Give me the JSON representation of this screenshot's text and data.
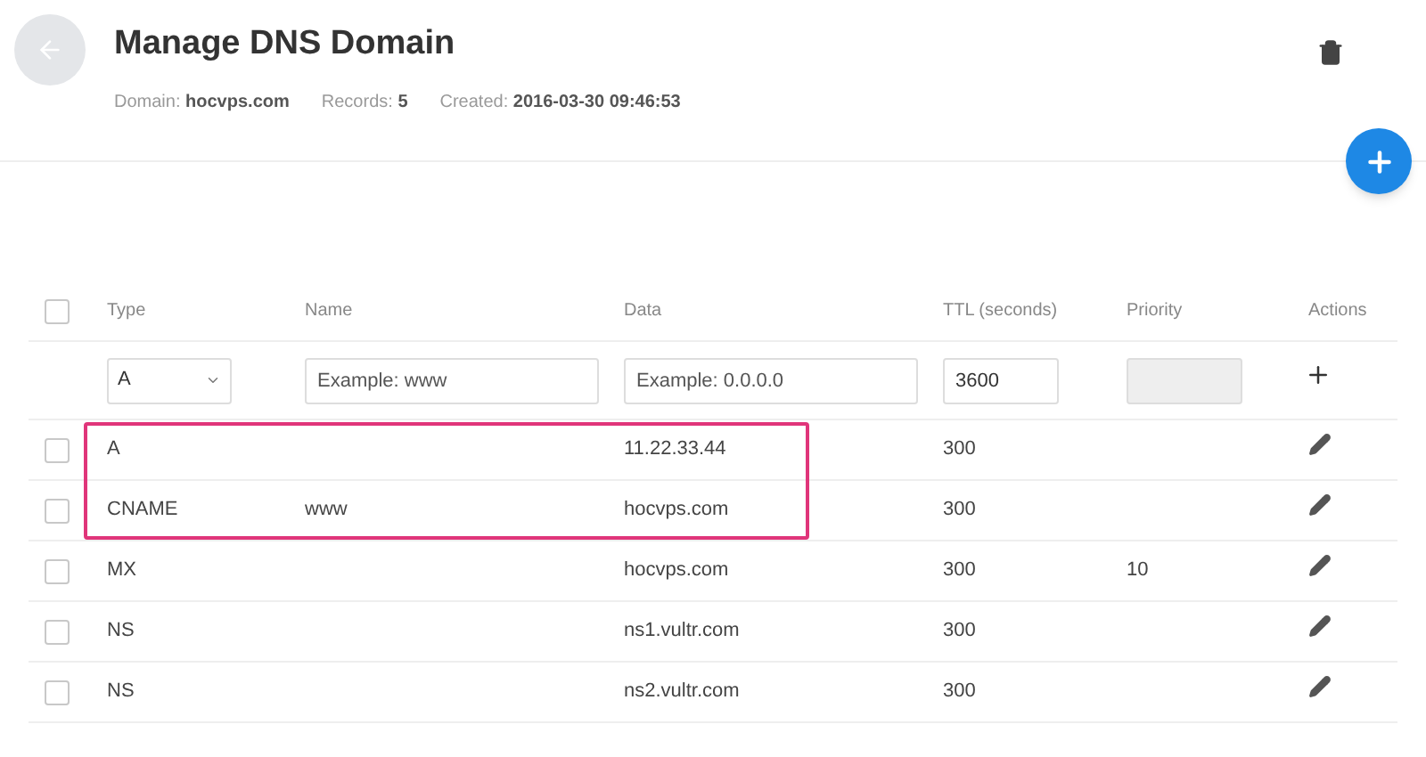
{
  "header": {
    "title": "Manage DNS Domain",
    "meta": [
      {
        "label": "Domain:",
        "value": "hocvps.com"
      },
      {
        "label": "Records:",
        "value": "5"
      },
      {
        "label": "Created:",
        "value": "2016-03-30 09:46:53"
      }
    ]
  },
  "table": {
    "select_all_checked": false,
    "columns": [
      "Type",
      "Name",
      "Data",
      "TTL (seconds)",
      "Priority",
      "Actions"
    ],
    "new_record": {
      "type": "A",
      "name_placeholder": "Example: www",
      "data_placeholder": "Example: 0.0.0.0",
      "ttl": "3600",
      "priority_disabled": true
    },
    "rows": [
      {
        "type": "A",
        "name": "",
        "data": "11.22.33.44",
        "ttl": "300",
        "priority": "",
        "checked": false,
        "highlighted": true
      },
      {
        "type": "CNAME",
        "name": "www",
        "data": "hocvps.com",
        "ttl": "300",
        "priority": "",
        "checked": false,
        "highlighted": true
      },
      {
        "type": "MX",
        "name": "",
        "data": "hocvps.com",
        "ttl": "300",
        "priority": "10",
        "checked": false,
        "highlighted": false
      },
      {
        "type": "NS",
        "name": "",
        "data": "ns1.vultr.com",
        "ttl": "300",
        "priority": "",
        "checked": false,
        "highlighted": false
      },
      {
        "type": "NS",
        "name": "",
        "data": "ns2.vultr.com",
        "ttl": "300",
        "priority": "",
        "checked": false,
        "highlighted": false
      }
    ]
  }
}
